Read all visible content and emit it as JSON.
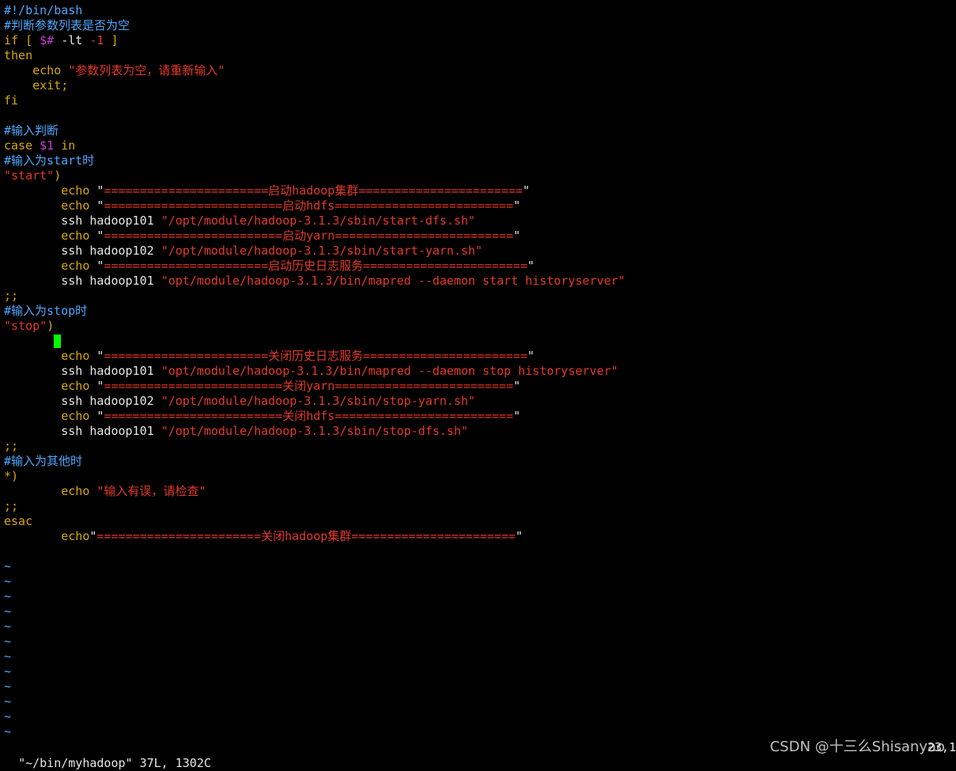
{
  "colors": {
    "background": "#000000",
    "comment": "#4fa8ff",
    "keyword": "#d7a70f",
    "string": "#e23a2a",
    "variable": "#c33dd1",
    "number": "#e23a2a",
    "plain": "#e6e6e6",
    "tilde": "#4fa8ff",
    "cursor": "#00ff00"
  },
  "lines": [
    [
      {
        "t": "#!/bin/bash",
        "c": "comment"
      }
    ],
    [
      {
        "t": "#判断参数列表是否为空",
        "c": "comment"
      }
    ],
    [
      {
        "t": "if",
        "c": "keyword"
      },
      {
        "t": " [ ",
        "c": "keyword"
      },
      {
        "t": "$#",
        "c": "variable"
      },
      {
        "t": " -lt ",
        "c": "plain"
      },
      {
        "t": "-1",
        "c": "number"
      },
      {
        "t": " ]",
        "c": "keyword"
      }
    ],
    [
      {
        "t": "then",
        "c": "keyword"
      }
    ],
    [
      {
        "t": "    echo ",
        "c": "keyword"
      },
      {
        "t": "\"参数列表为空，请重新输入\"",
        "c": "string"
      }
    ],
    [
      {
        "t": "    exit;",
        "c": "keyword"
      }
    ],
    [
      {
        "t": "fi",
        "c": "keyword"
      }
    ],
    [],
    [
      {
        "t": "#输入判断",
        "c": "comment"
      }
    ],
    [
      {
        "t": "case ",
        "c": "keyword"
      },
      {
        "t": "$1",
        "c": "variable"
      },
      {
        "t": " in",
        "c": "keyword"
      }
    ],
    [
      {
        "t": "#输入为start时",
        "c": "comment"
      }
    ],
    [
      {
        "t": "\"start\"",
        "c": "string"
      },
      {
        "t": ")",
        "c": "keyword"
      }
    ],
    [
      {
        "t": "        echo ",
        "c": "keyword"
      },
      {
        "t": "\"",
        "c": "plain"
      },
      {
        "t": "=======================启动hadoop集群=======================",
        "c": "string"
      },
      {
        "t": "\"",
        "c": "plain"
      }
    ],
    [
      {
        "t": "        echo ",
        "c": "keyword"
      },
      {
        "t": "\"",
        "c": "plain"
      },
      {
        "t": "=========================启动hdfs=========================",
        "c": "string"
      },
      {
        "t": "\"",
        "c": "plain"
      }
    ],
    [
      {
        "t": "        ssh hadoop101 ",
        "c": "plain"
      },
      {
        "t": "\"/opt/module/hadoop-3.1.3/sbin/start-dfs.sh\"",
        "c": "string"
      }
    ],
    [
      {
        "t": "        echo ",
        "c": "keyword"
      },
      {
        "t": "\"",
        "c": "plain"
      },
      {
        "t": "=========================启动yarn=========================",
        "c": "string"
      },
      {
        "t": "\"",
        "c": "plain"
      }
    ],
    [
      {
        "t": "        ssh hadoop102 ",
        "c": "plain"
      },
      {
        "t": "\"/opt/module/hadoop-3.1.3/sbin/start-yarn.sh\"",
        "c": "string"
      }
    ],
    [
      {
        "t": "        echo ",
        "c": "keyword"
      },
      {
        "t": "\"",
        "c": "plain"
      },
      {
        "t": "=======================启动历史日志服务=======================",
        "c": "string"
      },
      {
        "t": "\"",
        "c": "plain"
      }
    ],
    [
      {
        "t": "        ssh hadoop101 ",
        "c": "plain"
      },
      {
        "t": "\"opt/module/hadoop-3.1.3/bin/mapred --daemon start historyserver\"",
        "c": "string"
      }
    ],
    [
      {
        "t": ";;",
        "c": "keyword"
      }
    ],
    [
      {
        "t": "#输入为stop时",
        "c": "comment"
      }
    ],
    [
      {
        "t": "\"stop\"",
        "c": "string"
      },
      {
        "t": ")",
        "c": "keyword"
      }
    ],
    [
      {
        "t": "       ",
        "c": "plain"
      },
      {
        "t": "",
        "c": "cursor"
      }
    ],
    [
      {
        "t": "        echo ",
        "c": "keyword"
      },
      {
        "t": "\"",
        "c": "plain"
      },
      {
        "t": "=======================关闭历史日志服务=======================",
        "c": "string"
      },
      {
        "t": "\"",
        "c": "plain"
      }
    ],
    [
      {
        "t": "        ssh hadoop101 ",
        "c": "plain"
      },
      {
        "t": "\"opt/module/hadoop-3.1.3/bin/mapred --daemon stop historyserver\"",
        "c": "string"
      }
    ],
    [
      {
        "t": "        echo ",
        "c": "keyword"
      },
      {
        "t": "\"",
        "c": "plain"
      },
      {
        "t": "=========================关闭yarn=========================",
        "c": "string"
      },
      {
        "t": "\"",
        "c": "plain"
      }
    ],
    [
      {
        "t": "        ssh hadoop102 ",
        "c": "plain"
      },
      {
        "t": "\"/opt/module/hadoop-3.1.3/sbin/stop-yarn.sh\"",
        "c": "string"
      }
    ],
    [
      {
        "t": "        echo ",
        "c": "keyword"
      },
      {
        "t": "\"",
        "c": "plain"
      },
      {
        "t": "=========================关闭hdfs=========================",
        "c": "string"
      },
      {
        "t": "\"",
        "c": "plain"
      }
    ],
    [
      {
        "t": "        ssh hadoop101 ",
        "c": "plain"
      },
      {
        "t": "\"/opt/module/hadoop-3.1.3/sbin/stop-dfs.sh\"",
        "c": "string"
      }
    ],
    [
      {
        "t": ";;",
        "c": "keyword"
      }
    ],
    [
      {
        "t": "#输入为其他时",
        "c": "comment"
      }
    ],
    [
      {
        "t": "*)",
        "c": "keyword"
      }
    ],
    [
      {
        "t": "        echo ",
        "c": "keyword"
      },
      {
        "t": "\"输入有误，请检查\"",
        "c": "string"
      }
    ],
    [
      {
        "t": ";;",
        "c": "keyword"
      }
    ],
    [
      {
        "t": "esac",
        "c": "keyword"
      }
    ],
    [
      {
        "t": "        echo",
        "c": "keyword"
      },
      {
        "t": "\"",
        "c": "plain"
      },
      {
        "t": "=======================关闭hadoop集群=======================",
        "c": "string"
      },
      {
        "t": "\"",
        "c": "plain"
      }
    ],
    []
  ],
  "tilde_lines": [
    "~",
    "~",
    "~",
    "~",
    "~",
    "~",
    "~",
    "~",
    "~",
    "~",
    "~",
    "~"
  ],
  "statusbar": {
    "file_info": "\"~/bin/myhadoop\" 37L, 1302C",
    "cursor_position": "23,1"
  },
  "watermark": "CSDN @十三么Shisanyao"
}
